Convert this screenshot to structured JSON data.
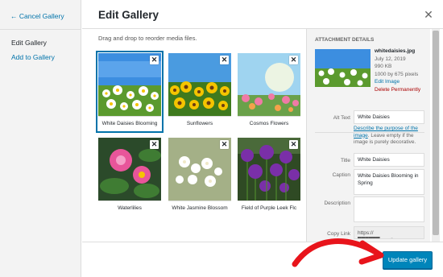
{
  "menu": {
    "back": "← Cancel Gallery",
    "current": "Edit Gallery",
    "add": "Add to Gallery"
  },
  "header": {
    "title": "Edit Gallery",
    "close_icon": "close-icon"
  },
  "instructions": "Drag and drop to reorder media files.",
  "thumbnails": [
    {
      "caption": "White Daisies Blooming",
      "selected": true
    },
    {
      "caption": "Sunflowers",
      "selected": false
    },
    {
      "caption": "Cosmos Flowers",
      "selected": false
    },
    {
      "caption": "Waterlilies",
      "selected": false
    },
    {
      "caption": "White Jasmine Blossom",
      "selected": false
    },
    {
      "caption": "Field of Purple Leek Flc",
      "selected": false
    }
  ],
  "attachment": {
    "heading": "ATTACHMENT DETAILS",
    "filename": "whitedaisies.jpg",
    "date": "July 12, 2019",
    "size": "990 KB",
    "dimensions": "1000 by 675 pixels",
    "edit_link": "Edit Image",
    "delete_link": "Delete Permanently",
    "alt_label": "Alt Text",
    "alt_value": "White Daisies",
    "alt_hint_link": "Describe the purpose of the image",
    "alt_hint_text": ". Leave empty if the image is purely decorative.",
    "title_label": "Title",
    "title_value": "White Daisies",
    "caption_label": "Caption",
    "caption_value": "White Daisies Blooming in Spring",
    "description_label": "Description",
    "description_value": "",
    "copy_label": "Copy Link",
    "copy_value": "https://██████rwpsite.com"
  },
  "footer": {
    "update_button": "Update gallery"
  },
  "colors": {
    "accent": "#0085ba",
    "link": "#0073aa",
    "arrow": "#e8141b"
  }
}
